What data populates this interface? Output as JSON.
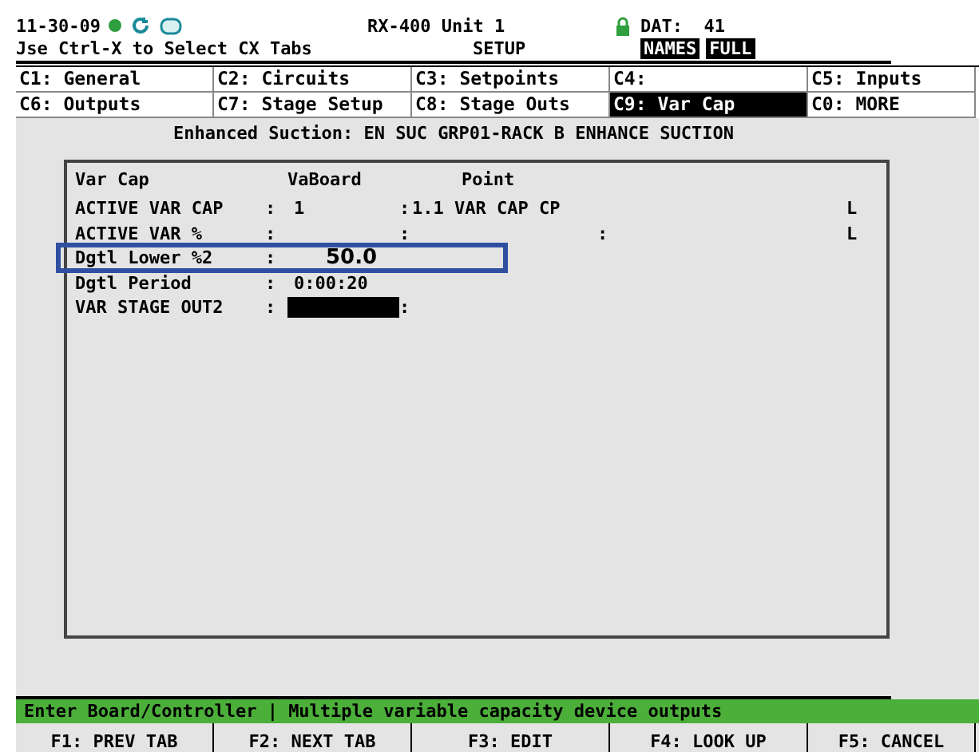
{
  "header": {
    "date": "11-30-09",
    "unit": "RX-400 Unit 1",
    "dat": "DAT:  41",
    "hint": "Jse Ctrl-X to Select CX Tabs",
    "mode": "SETUP",
    "badges": [
      "NAMES",
      "FULL"
    ]
  },
  "tabs": [
    {
      "label": "C1: General",
      "selected": false
    },
    {
      "label": "C2: Circuits",
      "selected": false
    },
    {
      "label": "C3: Setpoints",
      "selected": false
    },
    {
      "label": "C4:",
      "selected": false
    },
    {
      "label": "C5: Inputs",
      "selected": false
    },
    {
      "label": "C6: Outputs",
      "selected": false
    },
    {
      "label": "C7: Stage Setup",
      "selected": false
    },
    {
      "label": "C8: Stage Outs",
      "selected": false
    },
    {
      "label": "C9: Var Cap",
      "selected": true
    },
    {
      "label": "C0: MORE",
      "selected": false
    }
  ],
  "screen_title": "Enhanced Suction: EN SUC GRP01-RACK B ENHANCE SUCTION",
  "table": {
    "columns": [
      "Var Cap",
      "VaBoard",
      "Point"
    ],
    "rows": [
      {
        "label": "ACTIVE VAR CAP",
        "sep": ":",
        "board": "1",
        "point_sep": ":",
        "point": "1.1 VAR CAP CP",
        "flag": "L",
        "highlighted": false,
        "cursor": false
      },
      {
        "label": "ACTIVE VAR %",
        "sep": ":",
        "point_sep": ":",
        "extra_sep": ":",
        "flag": "L",
        "highlighted": false,
        "cursor": false
      },
      {
        "label": "Dgtl Lower %2",
        "sep": ":",
        "board": "50.0",
        "highlighted": true,
        "cursor": false
      },
      {
        "label": "Dgtl Period",
        "sep": ":",
        "board": "0:00:20",
        "highlighted": false,
        "cursor": false
      },
      {
        "label": "VAR STAGE OUT2",
        "sep": ":",
        "point_sep": ":",
        "highlighted": false,
        "cursor": true
      }
    ]
  },
  "status_bar": "Enter Board/Controller | Multiple variable capacity device outputs",
  "function_keys": [
    "F1: PREV TAB",
    "F2: NEXT TAB",
    "F3: EDIT",
    "F4: LOOK UP",
    "F5: CANCEL"
  ]
}
